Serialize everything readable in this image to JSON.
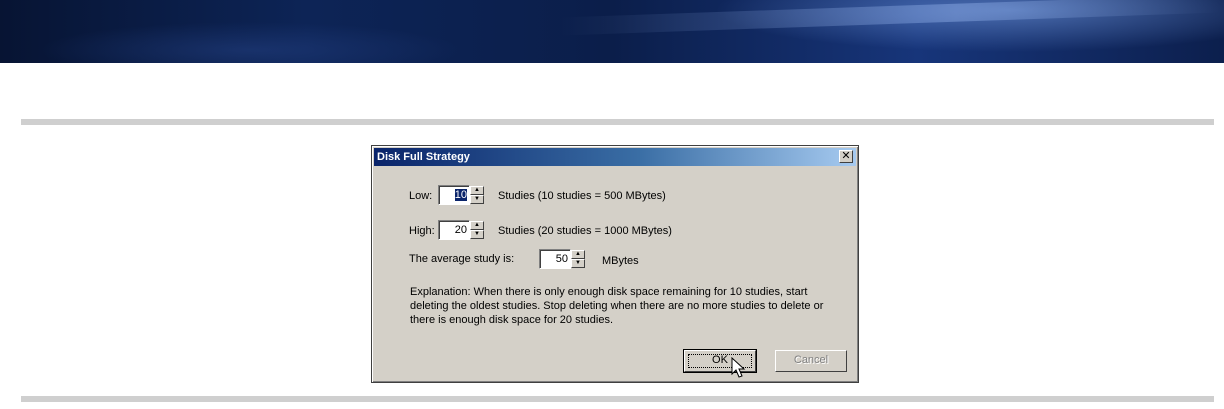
{
  "dialog": {
    "title": "Disk Full Strategy",
    "close_glyph": "✕",
    "low": {
      "label": "Low:",
      "value": "10",
      "note": "Studies (10 studies = 500 MBytes)"
    },
    "high": {
      "label": "High:",
      "value": "20",
      "note": "Studies (20 studies = 1000 MBytes)"
    },
    "average": {
      "label": "The average study is:",
      "value": "50",
      "unit": "MBytes"
    },
    "explanation": "Explanation: When there is only enough disk space remaining for 10 studies, start deleting the oldest studies.  Stop deleting when there are no more studies to delete or there is enough disk space for 20 studies.",
    "ok_label": "OK",
    "cancel_label": "Cancel"
  },
  "colors": {
    "dialog_bg": "#d4d0c8",
    "titlebar_start": "#0a246a",
    "titlebar_end": "#a6caf0",
    "selection": "#0a246a"
  },
  "icons": {
    "spin_up": "up-arrow-icon",
    "spin_down": "down-arrow-icon",
    "cursor": "mouse-pointer-icon",
    "close": "close-icon"
  }
}
